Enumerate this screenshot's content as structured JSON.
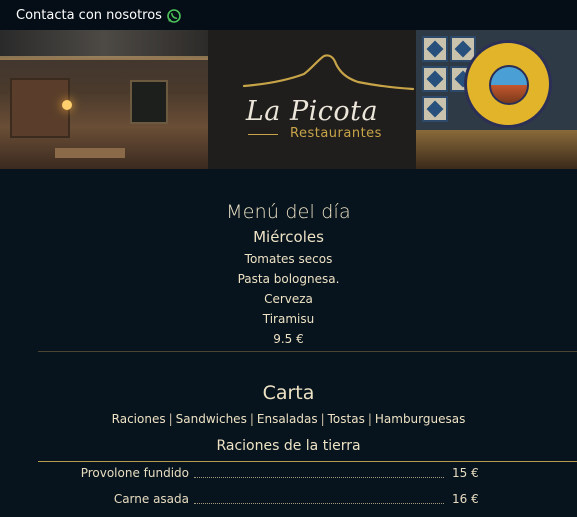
{
  "topbar": {
    "contact_label": "Contacta con nosotros",
    "whatsapp_icon": "whatsapp-icon",
    "whatsapp_color": "#4cc35a"
  },
  "hero": {
    "logo_title": "La Picota",
    "logo_subtitle": "Restaurantes",
    "accent_color": "#c8a449"
  },
  "menu_del_dia": {
    "title": "Menú del día",
    "day": "Miércoles",
    "items": [
      "Tomates secos",
      "Pasta bolognesa.",
      "Cerveza",
      "Tiramisu"
    ],
    "price": "9.5 €"
  },
  "carta": {
    "title": "Carta",
    "categories": [
      "Raciones",
      "Sandwiches",
      "Ensaladas",
      "Tostas",
      "Hamburguesas"
    ],
    "section_title": "Raciones de la tierra",
    "items": [
      {
        "name": "Provolone fundido",
        "price": "15 €"
      },
      {
        "name": "Carne asada",
        "price": "16 €"
      }
    ]
  },
  "colors": {
    "background": "#07131d",
    "text": "#ede2c4",
    "gold": "#c8a449"
  }
}
